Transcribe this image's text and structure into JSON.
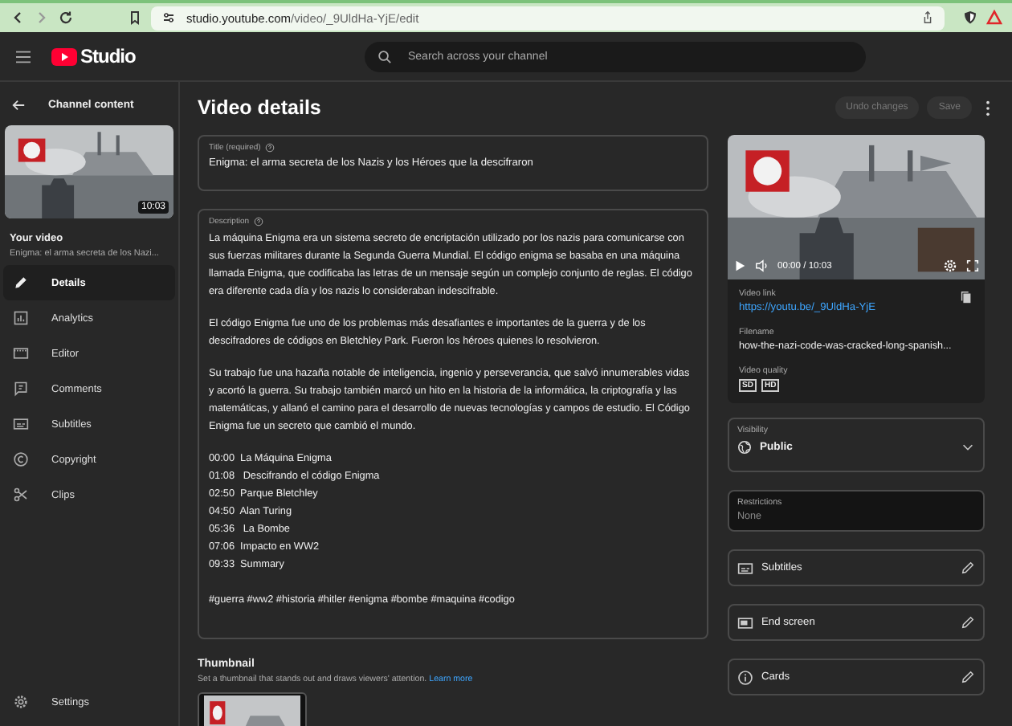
{
  "browser": {
    "url_host": "studio.youtube.com",
    "url_path": "/video/_9UldHa-YjE/edit"
  },
  "header": {
    "logo": "Studio",
    "search": {
      "placeholder": "Search across your channel"
    }
  },
  "sidebar": {
    "back_label": "Channel content",
    "duration": "10:03",
    "your_video": "Your video",
    "video_title": "Enigma: el arma secreta de los Nazi...",
    "items": [
      {
        "label": "Details",
        "kind": "pencil",
        "selected": true
      },
      {
        "label": "Analytics",
        "kind": "chart",
        "selected": false
      },
      {
        "label": "Editor",
        "kind": "editor",
        "selected": false
      },
      {
        "label": "Comments",
        "kind": "comment",
        "selected": false
      },
      {
        "label": "Subtitles",
        "kind": "subtitles",
        "selected": false
      },
      {
        "label": "Copyright",
        "kind": "copyright",
        "selected": false
      },
      {
        "label": "Clips",
        "kind": "scissors",
        "selected": false
      }
    ],
    "settings": "Settings"
  },
  "main": {
    "heading": "Video details",
    "undo": {
      "label": "Undo changes",
      "disabled": true
    },
    "save": {
      "label": "Save",
      "disabled": true
    },
    "title_field": {
      "label": "Title (required)",
      "value": "Enigma: el arma secreta de los Nazis y los Héroes que la descifraron"
    },
    "description": {
      "label": "Description",
      "paragraphs": [
        "La máquina Enigma era un sistema secreto de encriptación utilizado por los nazis para comunicarse con sus fuerzas militares durante la Segunda Guerra Mundial. El código enigma se basaba en una máquina llamada Enigma, que codificaba las letras de un mensaje según un complejo conjunto de reglas. El código era diferente cada día y los nazis lo consideraban indescifrable.",
        "El código Enigma fue uno de los problemas más desafiantes e importantes de la guerra y de los descifradores de códigos en Bletchley Park. Fueron los héroes quienes lo resolvieron.",
        "Su trabajo fue una hazaña notable de inteligencia, ingenio y perseverancia, que salvó innumerables vidas y acortó la guerra. Su trabajo también marcó un hito en la historia de la informática, la criptografía y las matemáticas, y allanó el camino para el desarrollo de nuevas tecnologías y campos de estudio. El Código Enigma fue un secreto que cambió el mundo."
      ],
      "chapters": [
        "00:00  La Máquina Enigma",
        "01:08   Descifrando el código Enigma",
        "02:50  Parque Bletchley",
        "04:50  Alan Turing",
        "05:36   La Bombe",
        "07:06  Impacto en WW2",
        "09:33  Summary"
      ],
      "hashtags": "#guerra #ww2 #historia #hitler #enigma #bombe #maquina #codigo"
    },
    "thumbnail": {
      "heading": "Thumbnail",
      "hint": "Set a thumbnail that stands out and draws viewers' attention.",
      "link": "Learn more"
    }
  },
  "side": {
    "player_time": "00:00 / 10:03",
    "video_link_label": "Video link",
    "video_link": "https://youtu.be/_9UldHa-YjE",
    "filename_label": "Filename",
    "filename": "how-the-nazi-code-was-cracked-long-spanish...",
    "quality_label": "Video quality",
    "qualities": [
      "SD",
      "HD"
    ],
    "visibility": {
      "label": "Visibility",
      "value": "Public"
    },
    "restrictions": {
      "label": "Restrictions",
      "value": "None"
    },
    "features": [
      {
        "label": "Subtitles",
        "kind": "subtitles"
      },
      {
        "label": "End screen",
        "kind": "endscreen"
      },
      {
        "label": "Cards",
        "kind": "info"
      }
    ]
  }
}
